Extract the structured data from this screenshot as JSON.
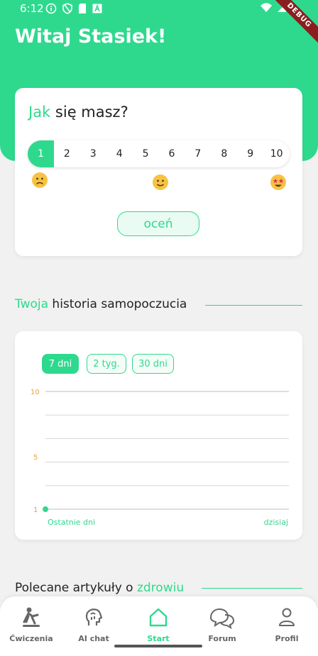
{
  "status_bar": {
    "time": "6:12",
    "icons": [
      "info-circle-icon",
      "shield-icon",
      "sd-card-icon",
      "a-box-icon"
    ],
    "right_icons": [
      "wifi-icon",
      "signal-icon"
    ],
    "debug_label": "DEBUG"
  },
  "header": {
    "greeting": "Witaj Stasiek!"
  },
  "mood": {
    "title_accent": "Jak",
    "title_rest": "się masz?",
    "scale": [
      "1",
      "2",
      "3",
      "4",
      "5",
      "6",
      "7",
      "8",
      "9",
      "10"
    ],
    "selected": 1,
    "rate_label": "oceń"
  },
  "history": {
    "title_accent": "Twoja",
    "title_rest": "historia samopoczucia",
    "ranges": [
      "7 dni",
      "2 tyg.",
      "30 dni"
    ],
    "selected_range": "7 dni"
  },
  "articles": {
    "title_rest": "Polecane artykuły o",
    "title_accent": "zdrowiu"
  },
  "chart_data": {
    "type": "line",
    "y_ticks": [
      "10",
      "5",
      "1"
    ],
    "ylim": [
      1,
      10
    ],
    "x_labels": [
      "Ostatnie dni",
      "dzisiaj"
    ],
    "series": [
      {
        "values": [
          1
        ]
      }
    ],
    "grid": true,
    "accent_color": "#2ed98e",
    "tick_color": "#e8a040"
  },
  "nav": {
    "items": [
      {
        "label": "Ćwiczenia",
        "icon": "exercise-icon"
      },
      {
        "label": "AI chat",
        "icon": "ai-head-icon"
      },
      {
        "label": "Start",
        "icon": "home-icon"
      },
      {
        "label": "Forum",
        "icon": "chat-bubbles-icon"
      },
      {
        "label": "Profil",
        "icon": "person-icon"
      }
    ],
    "active": "Start"
  },
  "colors": {
    "accent": "#2ed98e",
    "background": "#f1f1f1"
  }
}
